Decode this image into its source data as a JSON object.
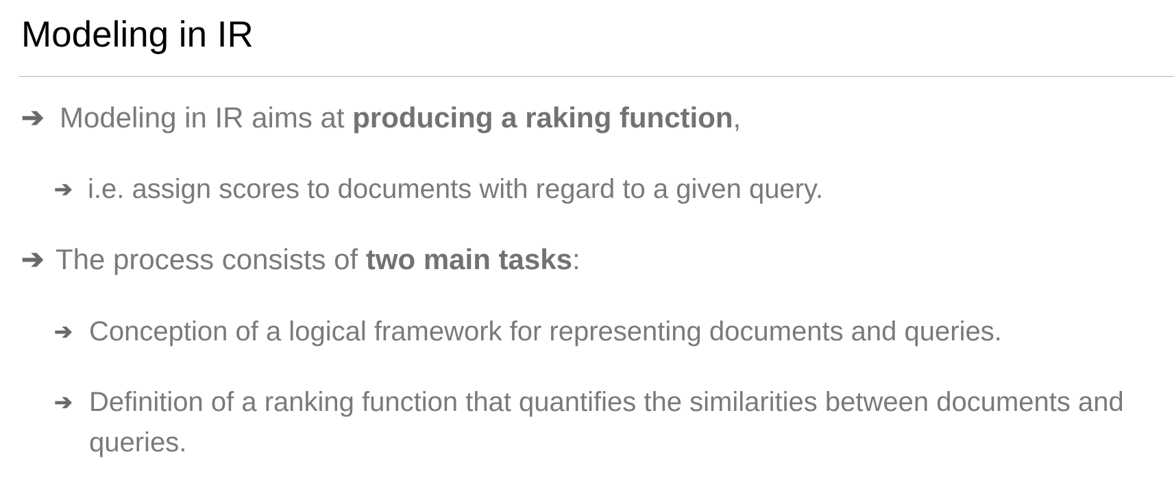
{
  "slide": {
    "title": "Modeling in IR",
    "bullet_symbol": "➔",
    "bullets": [
      {
        "before": "Modeling in IR aims at ",
        "bold": "producing a raking function",
        "after": ","
      },
      {
        "text": "i.e. assign scores to documents with regard to a given query."
      },
      {
        "before": "The process consists of ",
        "bold": "two main tasks",
        "after": ":"
      },
      {
        "text": "Conception of a logical framework for representing documents and queries."
      },
      {
        "text": "Definition of a ranking function that quantifies the similarities between documents and queries."
      }
    ]
  },
  "colors": {
    "title": "#000000",
    "body_text": "#7a7a7a",
    "bold_text": "#727272",
    "rule": "#b4b4b4",
    "background": "#ffffff"
  }
}
